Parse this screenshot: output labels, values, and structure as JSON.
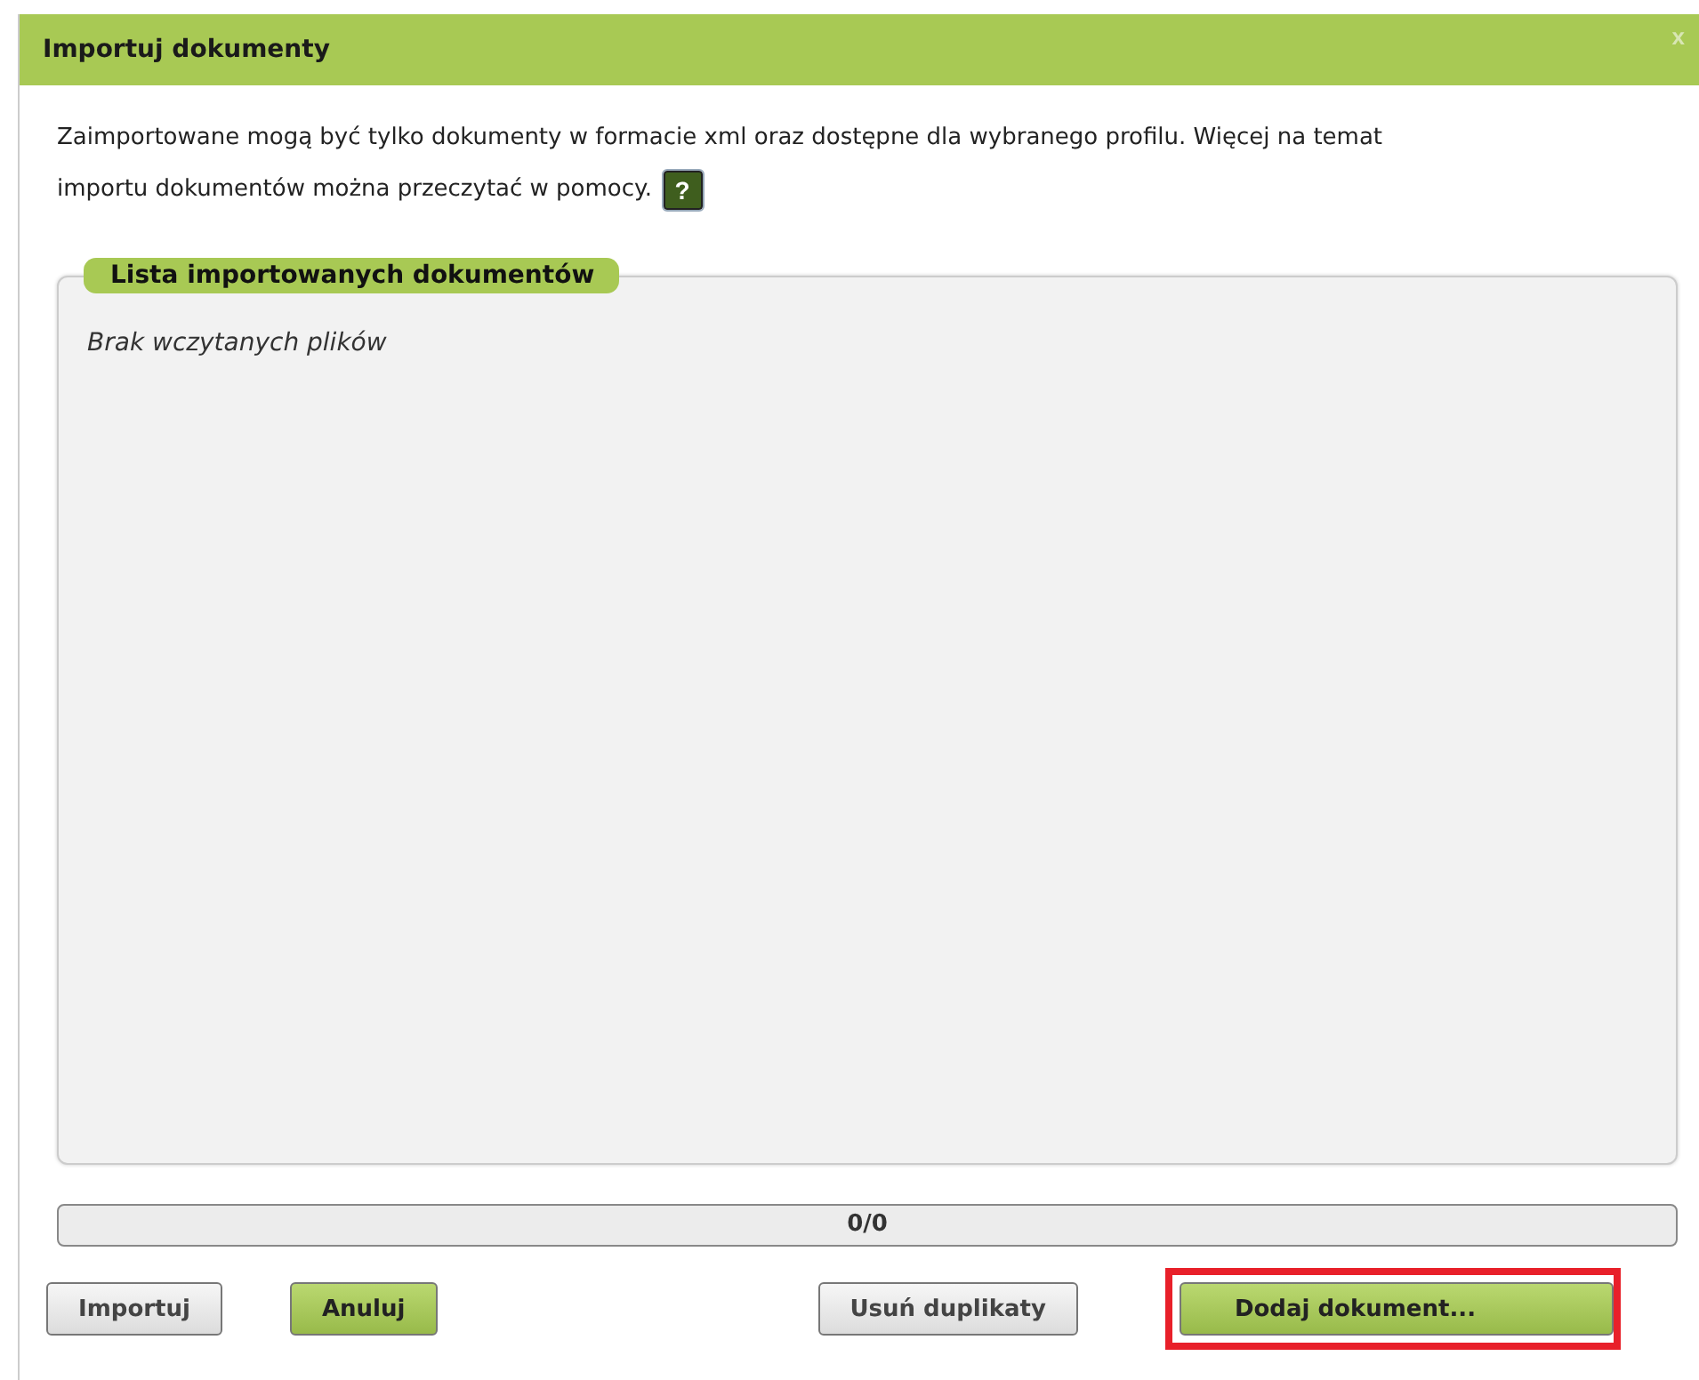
{
  "dialog": {
    "title": "Importuj dokumenty",
    "close": "x",
    "intro_lines": [
      "Zaimportowane mogą być tylko dokumenty w formacie xml oraz dostępne dla wybranego profilu. Więcej na temat",
      "importu dokumentów można przeczytać w pomocy."
    ],
    "help": "?"
  },
  "list": {
    "legend": "Lista importowanych dokumentów",
    "empty": "Brak wczytanych plików"
  },
  "progress": {
    "label": "0/0"
  },
  "buttons": [
    {
      "label": "Importuj",
      "kind": "plain",
      "highlighted": false
    },
    {
      "label": "Anuluj",
      "kind": "accent",
      "highlighted": false
    },
    {
      "label": "Usuń duplikaty",
      "kind": "plain",
      "highlighted": false
    },
    {
      "label": "Dodaj dokument...",
      "kind": "accent",
      "highlighted": true
    }
  ]
}
